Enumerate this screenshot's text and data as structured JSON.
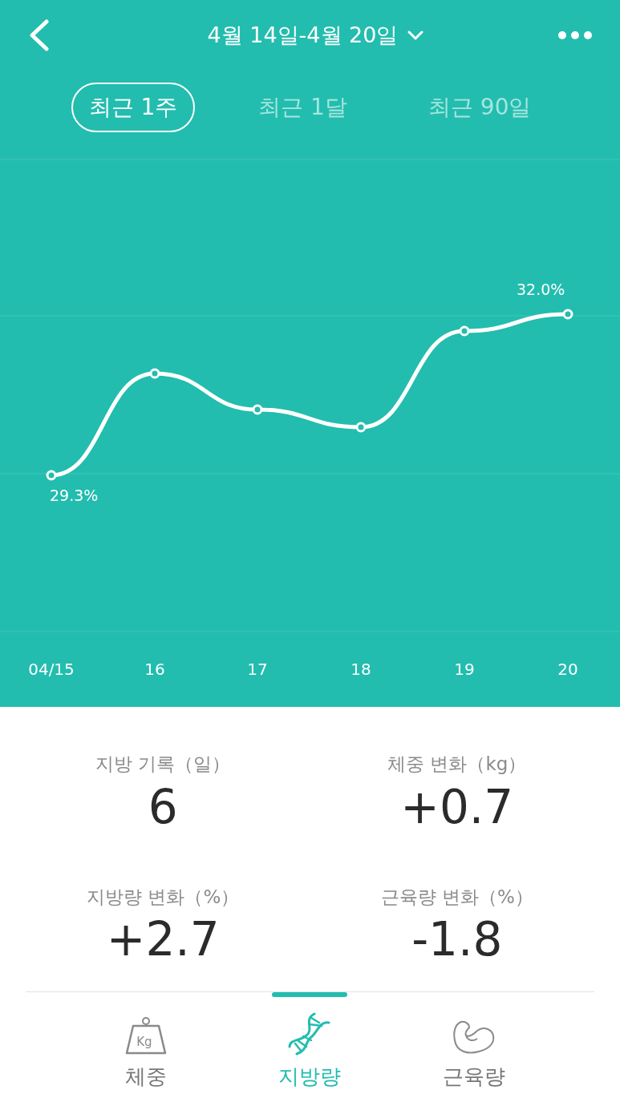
{
  "header": {
    "title": "4월 14일-4월 20일"
  },
  "ranges": [
    {
      "label": "최근 1주",
      "selected": true
    },
    {
      "label": "최근 1달",
      "selected": false
    },
    {
      "label": "최근 90일",
      "selected": false
    }
  ],
  "chart": {
    "x_labels": [
      "04/15",
      "16",
      "17",
      "18",
      "19",
      "20"
    ],
    "point_labels": [
      "29.3%",
      "32.0%"
    ]
  },
  "stats": [
    {
      "label": "지방 기록（일）",
      "value": "6"
    },
    {
      "label": "체중 변화（kg）",
      "value": "+0.7"
    },
    {
      "label": "지방량 변화（%）",
      "value": "+2.7"
    },
    {
      "label": "근육량 변화（%）",
      "value": "-1.8"
    }
  ],
  "bottom_tabs": [
    {
      "kind": "weight",
      "label": "체중",
      "icon_label": "Kg",
      "selected": false
    },
    {
      "kind": "dna",
      "label": "지방량",
      "selected": true
    },
    {
      "kind": "muscle",
      "label": "근육량",
      "selected": false
    }
  ]
}
